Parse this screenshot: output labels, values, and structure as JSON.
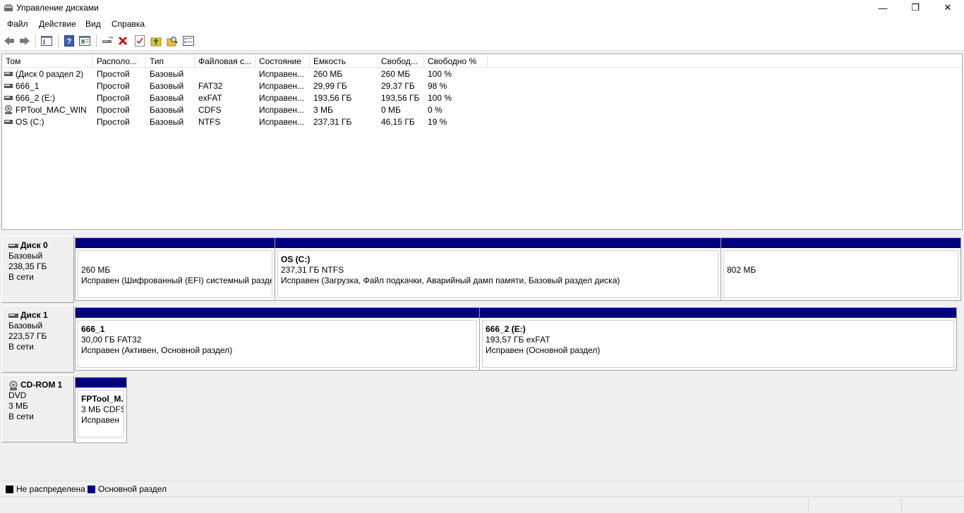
{
  "window": {
    "title": "Управление дисками",
    "minimize": "—",
    "restore": "❐",
    "close": "✕"
  },
  "menu": [
    "Файл",
    "Действие",
    "Вид",
    "Справка"
  ],
  "toolbar": [
    "back-icon",
    "forward-icon",
    "console-tree-icon",
    "help-icon",
    "properties-icon",
    "connect-drive-icon",
    "delete-icon",
    "check-icon",
    "folder-up-icon",
    "search-folder-icon",
    "list-view-icon"
  ],
  "columns": [
    "Том",
    "Располо...",
    "Тип",
    "Файловая с...",
    "Состояние",
    "Емкость",
    "Свобод...",
    "Свободно %"
  ],
  "volumes": [
    {
      "icon": "disk-icon",
      "name": "(Диск 0 раздел 2)",
      "layout": "Простой",
      "type": "Базовый",
      "fs": "",
      "status": "Исправен...",
      "capacity": "260 МБ",
      "free": "260 МБ",
      "free_pct": "100 %"
    },
    {
      "icon": "disk-icon",
      "name": "666_1",
      "layout": "Простой",
      "type": "Базовый",
      "fs": "FAT32",
      "status": "Исправен...",
      "capacity": "29,99 ГБ",
      "free": "29,37 ГБ",
      "free_pct": "98 %"
    },
    {
      "icon": "disk-icon",
      "name": "666_2 (E:)",
      "layout": "Простой",
      "type": "Базовый",
      "fs": "exFAT",
      "status": "Исправен...",
      "capacity": "193,56 ГБ",
      "free": "193,56 ГБ",
      "free_pct": "100 %"
    },
    {
      "icon": "cdrom-icon",
      "name": "FPTool_MAC_WIN",
      "layout": "Простой",
      "type": "Базовый",
      "fs": "CDFS",
      "status": "Исправен...",
      "capacity": "3 МБ",
      "free": "0 МБ",
      "free_pct": "0 %"
    },
    {
      "icon": "disk-icon",
      "name": "OS (C:)",
      "layout": "Простой",
      "type": "Базовый",
      "fs": "NTFS",
      "status": "Исправен...",
      "capacity": "237,31 ГБ",
      "free": "46,15 ГБ",
      "free_pct": "19 %"
    }
  ],
  "disks": [
    {
      "name": "Диск 0",
      "kind": "Базовый",
      "size": "238,35 ГБ",
      "state": "В сети",
      "partitions": [
        {
          "title": "",
          "line1": "260 МБ",
          "line2": "Исправен (Шифрованный (EFI) системный разде"
        },
        {
          "title": "OS  (C:)",
          "line1": "237,31 ГБ NTFS",
          "line2": "Исправен (Загрузка, Файл подкачки, Аварийный дамп памяти, Базовый раздел диска)"
        },
        {
          "title": "",
          "line1": "802 МБ",
          "line2": ""
        }
      ]
    },
    {
      "name": "Диск 1",
      "kind": "Базовый",
      "size": "223,57 ГБ",
      "state": "В сети",
      "partitions": [
        {
          "title": "666_1",
          "line1": "30,00 ГБ FAT32",
          "line2": "Исправен (Активен, Основной раздел)"
        },
        {
          "title": "666_2  (E:)",
          "line1": "193,57 ГБ exFAT",
          "line2": "Исправен (Основной раздел)"
        }
      ]
    },
    {
      "name": "CD-ROM 1",
      "kind": "DVD",
      "size": "3 МБ",
      "state": "В сети",
      "partitions": [
        {
          "title": "FPTool_M...",
          "line1": "3 МБ CDFS",
          "line2": "Исправен"
        }
      ]
    }
  ],
  "legend": [
    {
      "label": "Не распределена",
      "color": "#000000"
    },
    {
      "label": "Основной раздел",
      "color": "#00007f"
    }
  ]
}
